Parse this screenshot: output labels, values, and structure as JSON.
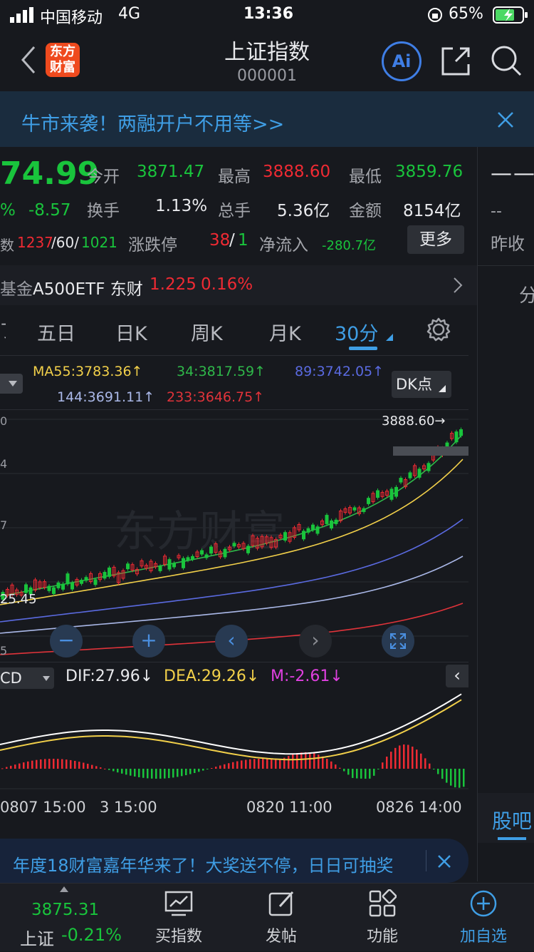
{
  "status": {
    "carrier": "中国移动",
    "network": "4G",
    "time": "13:36",
    "battery": "65%"
  },
  "header": {
    "title": "上证指数",
    "code": "000001",
    "logo_line1": "东方",
    "logo_line2": "财富",
    "ai_label": "Ai"
  },
  "banner": {
    "text": "牛市来袭！两融开户不用等>>"
  },
  "quote": {
    "price": "74.99",
    "pct": "%",
    "change": "-8.57",
    "count_label": "数",
    "count_up": "1237",
    "count_flat": "/60/",
    "count_down": "1021",
    "open_label": "今开",
    "open": "3871.47",
    "high_label": "最高",
    "high": "3888.60",
    "low_label": "最低",
    "low": "3859.76",
    "turnover_label": "换手",
    "turnover": "1.13%",
    "volume_label": "总手",
    "volume": "5.36亿",
    "amount_label": "金额",
    "amount": "8154亿",
    "limit_label": "涨跌停",
    "limit_up": "38",
    "limit_sep": "/",
    "limit_down": "1",
    "inflow_label": "净流入",
    "inflow": "-280.7亿",
    "more_label": "更多"
  },
  "right_panel": {
    "top": "——",
    "mid": "--",
    "prev_close_label": "昨收",
    "fen": "分",
    "guba": "股吧"
  },
  "fund": {
    "prefix": "基金",
    "name": "A500ETF 东财",
    "price": "1.225",
    "pct": "0.16%"
  },
  "tabs": [
    {
      "label": "五日"
    },
    {
      "label": "日K"
    },
    {
      "label": "周K"
    },
    {
      "label": "月K"
    },
    {
      "label": "30分"
    }
  ],
  "indicators": {
    "ma55": "MA55:3783.36↑",
    "ma34": "34:3817.59↑",
    "ma89": "89:3742.05↑",
    "ma144": "144:3691.11↑",
    "ma233": "233:3646.75↑",
    "dk": "DK点"
  },
  "chart_labels": {
    "high_tag": "3888.60→",
    "low_tag": "25.45",
    "ax0": "0",
    "ax1": "4",
    "ax2": "7",
    "ax3": "5",
    "watermark": "东方财富"
  },
  "macd": {
    "name": "CD",
    "dif": "DIF:27.96↓",
    "dea": "DEA:29.26↓",
    "m": "M:-2.61↓"
  },
  "dates": [
    "0807 15:00",
    "3 15:00",
    "0820 11:00",
    "0826 14:00"
  ],
  "bottom_ad": {
    "text": "年度18财富嘉年华来了！大奖送不停，日日可抽奖"
  },
  "tabbar": {
    "index_value": "3875.31",
    "index_name": "上证",
    "index_pct": "-0.21%",
    "buy": "买指数",
    "post": "发帖",
    "func": "功能",
    "add": "加自选"
  },
  "colors": {
    "up": "#ef2a33",
    "down": "#19c43c",
    "accent": "#3f9ee5",
    "bg": "#17191e"
  }
}
